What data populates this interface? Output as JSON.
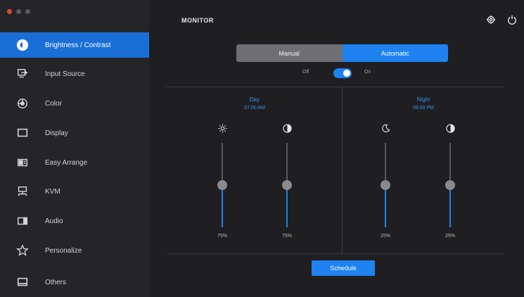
{
  "window": {
    "title": "MONITOR",
    "accent_color": "#1e82f0"
  },
  "sidebar": {
    "items": [
      {
        "label": "Brightness / Contrast",
        "icon": "brightness-icon",
        "active": true
      },
      {
        "label": "Input Source",
        "icon": "input-source-icon",
        "active": false
      },
      {
        "label": "Color",
        "icon": "color-icon",
        "active": false
      },
      {
        "label": "Display",
        "icon": "display-icon",
        "active": false
      },
      {
        "label": "Easy Arrange",
        "icon": "easy-arrange-icon",
        "active": false
      },
      {
        "label": "KVM",
        "icon": "kvm-icon",
        "active": false
      },
      {
        "label": "Audio",
        "icon": "audio-icon",
        "active": false
      },
      {
        "label": "Personalize",
        "icon": "personalize-icon",
        "active": false
      },
      {
        "label": "Others",
        "icon": "others-icon",
        "active": false
      }
    ]
  },
  "header": {
    "settings_icon": "gear-icon",
    "power_icon": "power-icon"
  },
  "mode": {
    "manual_label": "Manual",
    "auto_label": "Automatic",
    "selected": "Automatic"
  },
  "toggle": {
    "off_label": "Off",
    "on_label": "On",
    "state": "on"
  },
  "panels": {
    "day": {
      "title": "Day",
      "time": "07:00 AM",
      "brightness_value": "75%",
      "contrast_value": "75%",
      "brightness_level": 0.5,
      "contrast_level": 0.5
    },
    "night": {
      "title": "Night",
      "time": "08:00 PM",
      "brightness_value": "25%",
      "contrast_value": "25%",
      "brightness_level": 0.5,
      "contrast_level": 0.5
    }
  },
  "apply_label": "Schedule"
}
